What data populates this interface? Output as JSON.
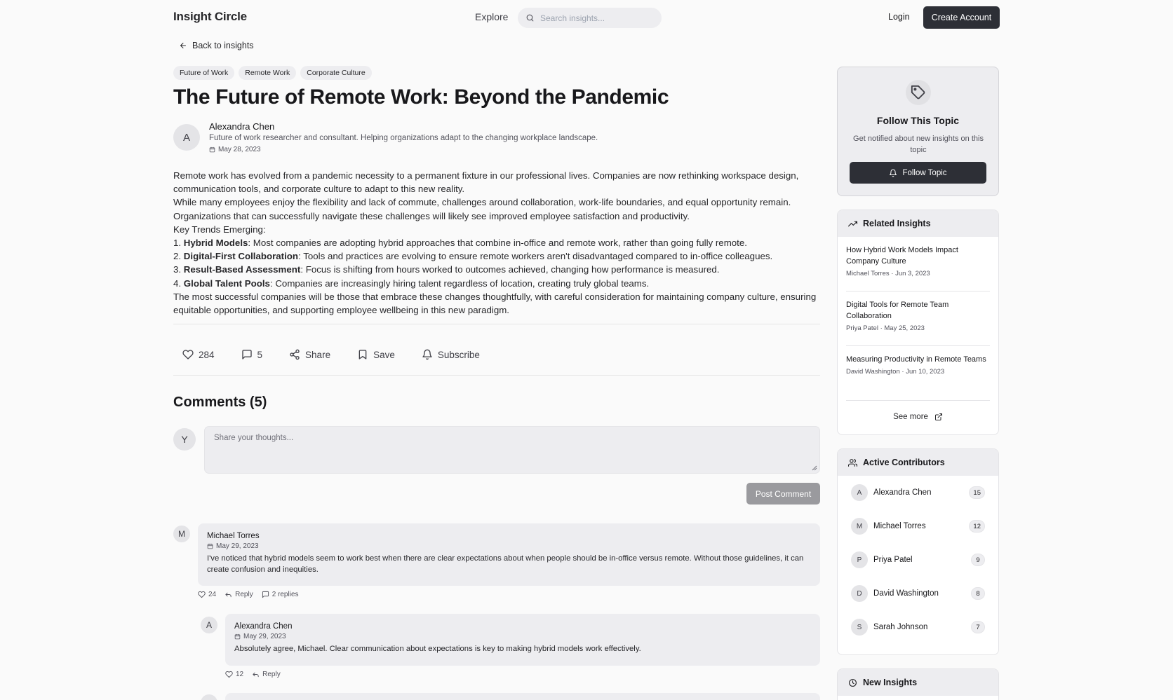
{
  "header": {
    "brand": "Insight Circle",
    "explore": "Explore",
    "search_placeholder": "Search insights...",
    "login": "Login",
    "create_account": "Create Account"
  },
  "back_link": "Back to insights",
  "tags": [
    "Future of Work",
    "Remote Work",
    "Corporate Culture"
  ],
  "article": {
    "title": "The Future of Remote Work: Beyond the Pandemic",
    "author": {
      "initial": "A",
      "name": "Alexandra Chen",
      "bio": "Future of work researcher and consultant. Helping organizations adapt to the changing workplace landscape.",
      "date": "May 28, 2023"
    },
    "para1": "Remote work has evolved from a pandemic necessity to a permanent fixture in our professional lives. Companies are now rethinking workspace design, communication tools, and corporate culture to adapt to this new reality.",
    "para2": "While many employees enjoy the flexibility and lack of commute, challenges around collaboration, work-life boundaries, and equal opportunity remain. Organizations that can successfully navigate these challenges will likely see improved employee satisfaction and productivity.",
    "trends_heading": "Key Trends Emerging:",
    "trends": [
      {
        "num": "1. ",
        "term": "Hybrid Models",
        "desc": ": Most companies are adopting hybrid approaches that combine in-office and remote work, rather than going fully remote."
      },
      {
        "num": "2. ",
        "term": "Digital-First Collaboration",
        "desc": ": Tools and practices are evolving to ensure remote workers aren't disadvantaged compared to in-office colleagues."
      },
      {
        "num": "3. ",
        "term": "Result-Based Assessment",
        "desc": ": Focus is shifting from hours worked to outcomes achieved, changing how performance is measured."
      },
      {
        "num": "4. ",
        "term": "Global Talent Pools",
        "desc": ": Companies are increasingly hiring talent regardless of location, creating truly global teams."
      }
    ],
    "conclusion": "The most successful companies will be those that embrace these changes thoughtfully, with careful consideration for maintaining company culture, ensuring equitable opportunities, and supporting employee wellbeing in this new paradigm."
  },
  "actions": {
    "likes": "284",
    "comments": "5",
    "share": "Share",
    "save": "Save",
    "subscribe": "Subscribe"
  },
  "comments": {
    "title": "Comments (5)",
    "user_initial": "Y",
    "placeholder": "Share your thoughts...",
    "post_button": "Post Comment",
    "items": [
      {
        "initial": "M",
        "name": "Michael Torres",
        "date": "May 29, 2023",
        "text": "I've noticed that hybrid models seem to work best when there are clear expectations about when people should be in-office versus remote. Without those guidelines, it can create confusion and inequities.",
        "likes": "24",
        "reply": "Reply",
        "replies": "2 replies"
      },
      {
        "initial": "A",
        "name": "Alexandra Chen",
        "date": "May 29, 2023",
        "text": "Absolutely agree, Michael. Clear communication about expectations is key to making hybrid models work effectively.",
        "likes": "12",
        "reply": "Reply"
      }
    ]
  },
  "sidebar": {
    "follow": {
      "title": "Follow This Topic",
      "desc": "Get notified about new insights on this topic",
      "button": "Follow Topic"
    },
    "related": {
      "title": "Related Insights",
      "items": [
        {
          "title": "How Hybrid Work Models Impact Company Culture",
          "author": "Michael Torres",
          "date": "Jun 3, 2023"
        },
        {
          "title": "Digital Tools for Remote Team Collaboration",
          "author": "Priya Patel",
          "date": "May 25, 2023"
        },
        {
          "title": "Measuring Productivity in Remote Teams",
          "author": "David Washington",
          "date": "Jun 10, 2023"
        }
      ],
      "see_more": "See more"
    },
    "contributors": {
      "title": "Active Contributors",
      "items": [
        {
          "initial": "A",
          "name": "Alexandra Chen",
          "count": "15"
        },
        {
          "initial": "M",
          "name": "Michael Torres",
          "count": "12"
        },
        {
          "initial": "P",
          "name": "Priya Patel",
          "count": "9"
        },
        {
          "initial": "D",
          "name": "David Washington",
          "count": "8"
        },
        {
          "initial": "S",
          "name": "Sarah Johnson",
          "count": "7"
        }
      ]
    },
    "new_insights": {
      "title": "New Insights"
    }
  },
  "colors": {
    "primary_dark": "#2d2f36",
    "surface_gray": "#ededf0",
    "page_bg": "#fafafa"
  }
}
